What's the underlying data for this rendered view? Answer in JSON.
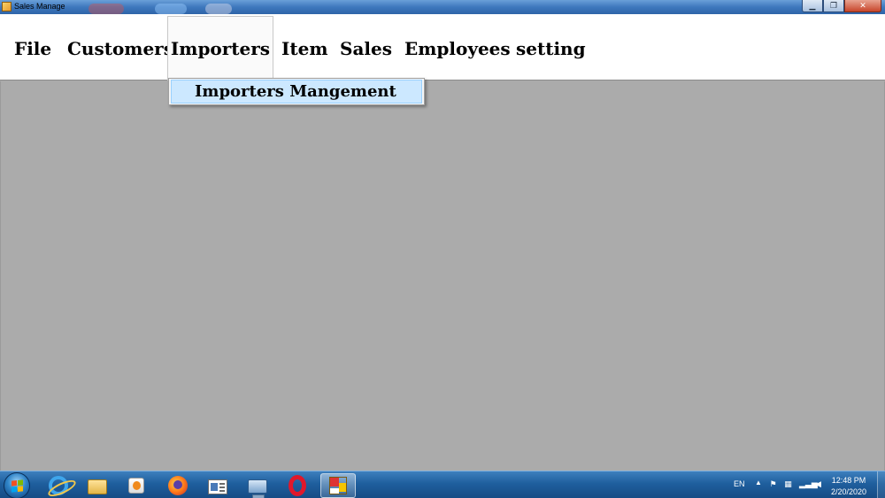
{
  "window": {
    "title": "Sales Manage",
    "buttons": {
      "minimize": "▁",
      "maximize": "❐",
      "close": "✕"
    }
  },
  "menu": {
    "items": [
      {
        "label": "File"
      },
      {
        "label": "Customers"
      },
      {
        "label": "Importers",
        "open": true
      },
      {
        "label": "Item"
      },
      {
        "label": "Sales"
      },
      {
        "label": "Employees"
      },
      {
        "label": "setting"
      }
    ],
    "dropdown": {
      "items": [
        {
          "label": "Importers Mangement",
          "highlighted": true
        }
      ]
    }
  },
  "colors": {
    "workspace": "#ababab",
    "menu_bg": "#ffffff",
    "highlight": "#cce8ff",
    "taskbar": "#1f5f9e"
  },
  "taskbar": {
    "apps": [
      {
        "icon": "internet-explorer-icon"
      },
      {
        "icon": "file-explorer-icon"
      },
      {
        "icon": "media-player-icon"
      },
      {
        "icon": "firefox-icon"
      },
      {
        "icon": "window-app-icon"
      },
      {
        "icon": "computer-icon"
      },
      {
        "icon": "opera-icon"
      },
      {
        "icon": "sales-manage-app-icon",
        "active": true
      }
    ],
    "tray": {
      "language": "EN",
      "time": "12:48 PM",
      "date": "2/20/2020"
    }
  }
}
